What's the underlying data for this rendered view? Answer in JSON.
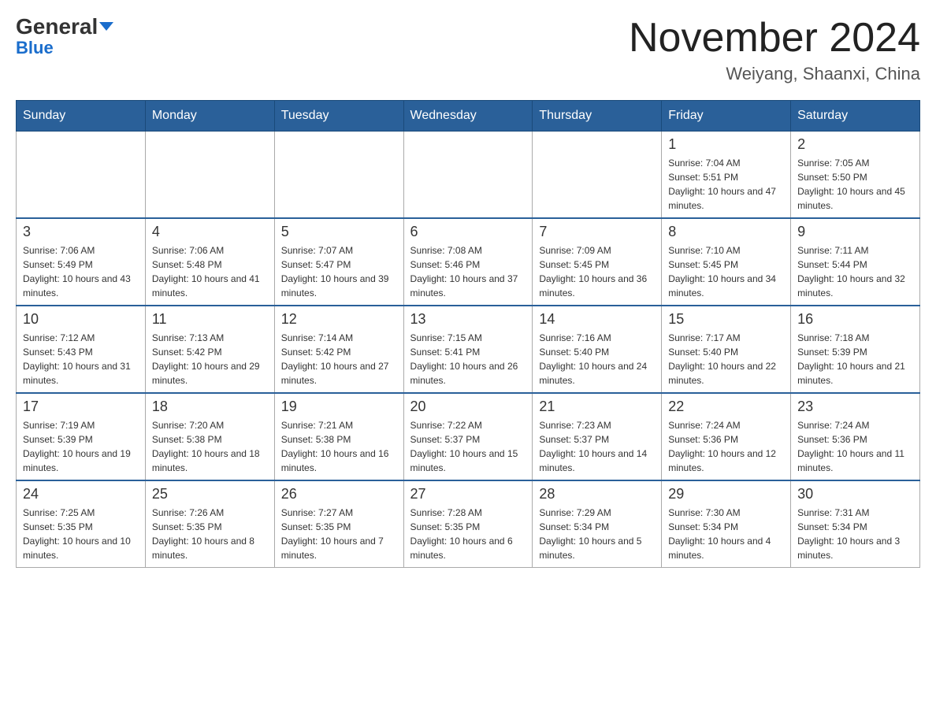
{
  "header": {
    "logo_main": "General",
    "logo_sub": "Blue",
    "month_title": "November 2024",
    "location": "Weiyang, Shaanxi, China"
  },
  "weekdays": [
    "Sunday",
    "Monday",
    "Tuesday",
    "Wednesday",
    "Thursday",
    "Friday",
    "Saturday"
  ],
  "weeks": [
    [
      {
        "day": "",
        "info": ""
      },
      {
        "day": "",
        "info": ""
      },
      {
        "day": "",
        "info": ""
      },
      {
        "day": "",
        "info": ""
      },
      {
        "day": "",
        "info": ""
      },
      {
        "day": "1",
        "info": "Sunrise: 7:04 AM\nSunset: 5:51 PM\nDaylight: 10 hours and 47 minutes."
      },
      {
        "day": "2",
        "info": "Sunrise: 7:05 AM\nSunset: 5:50 PM\nDaylight: 10 hours and 45 minutes."
      }
    ],
    [
      {
        "day": "3",
        "info": "Sunrise: 7:06 AM\nSunset: 5:49 PM\nDaylight: 10 hours and 43 minutes."
      },
      {
        "day": "4",
        "info": "Sunrise: 7:06 AM\nSunset: 5:48 PM\nDaylight: 10 hours and 41 minutes."
      },
      {
        "day": "5",
        "info": "Sunrise: 7:07 AM\nSunset: 5:47 PM\nDaylight: 10 hours and 39 minutes."
      },
      {
        "day": "6",
        "info": "Sunrise: 7:08 AM\nSunset: 5:46 PM\nDaylight: 10 hours and 37 minutes."
      },
      {
        "day": "7",
        "info": "Sunrise: 7:09 AM\nSunset: 5:45 PM\nDaylight: 10 hours and 36 minutes."
      },
      {
        "day": "8",
        "info": "Sunrise: 7:10 AM\nSunset: 5:45 PM\nDaylight: 10 hours and 34 minutes."
      },
      {
        "day": "9",
        "info": "Sunrise: 7:11 AM\nSunset: 5:44 PM\nDaylight: 10 hours and 32 minutes."
      }
    ],
    [
      {
        "day": "10",
        "info": "Sunrise: 7:12 AM\nSunset: 5:43 PM\nDaylight: 10 hours and 31 minutes."
      },
      {
        "day": "11",
        "info": "Sunrise: 7:13 AM\nSunset: 5:42 PM\nDaylight: 10 hours and 29 minutes."
      },
      {
        "day": "12",
        "info": "Sunrise: 7:14 AM\nSunset: 5:42 PM\nDaylight: 10 hours and 27 minutes."
      },
      {
        "day": "13",
        "info": "Sunrise: 7:15 AM\nSunset: 5:41 PM\nDaylight: 10 hours and 26 minutes."
      },
      {
        "day": "14",
        "info": "Sunrise: 7:16 AM\nSunset: 5:40 PM\nDaylight: 10 hours and 24 minutes."
      },
      {
        "day": "15",
        "info": "Sunrise: 7:17 AM\nSunset: 5:40 PM\nDaylight: 10 hours and 22 minutes."
      },
      {
        "day": "16",
        "info": "Sunrise: 7:18 AM\nSunset: 5:39 PM\nDaylight: 10 hours and 21 minutes."
      }
    ],
    [
      {
        "day": "17",
        "info": "Sunrise: 7:19 AM\nSunset: 5:39 PM\nDaylight: 10 hours and 19 minutes."
      },
      {
        "day": "18",
        "info": "Sunrise: 7:20 AM\nSunset: 5:38 PM\nDaylight: 10 hours and 18 minutes."
      },
      {
        "day": "19",
        "info": "Sunrise: 7:21 AM\nSunset: 5:38 PM\nDaylight: 10 hours and 16 minutes."
      },
      {
        "day": "20",
        "info": "Sunrise: 7:22 AM\nSunset: 5:37 PM\nDaylight: 10 hours and 15 minutes."
      },
      {
        "day": "21",
        "info": "Sunrise: 7:23 AM\nSunset: 5:37 PM\nDaylight: 10 hours and 14 minutes."
      },
      {
        "day": "22",
        "info": "Sunrise: 7:24 AM\nSunset: 5:36 PM\nDaylight: 10 hours and 12 minutes."
      },
      {
        "day": "23",
        "info": "Sunrise: 7:24 AM\nSunset: 5:36 PM\nDaylight: 10 hours and 11 minutes."
      }
    ],
    [
      {
        "day": "24",
        "info": "Sunrise: 7:25 AM\nSunset: 5:35 PM\nDaylight: 10 hours and 10 minutes."
      },
      {
        "day": "25",
        "info": "Sunrise: 7:26 AM\nSunset: 5:35 PM\nDaylight: 10 hours and 8 minutes."
      },
      {
        "day": "26",
        "info": "Sunrise: 7:27 AM\nSunset: 5:35 PM\nDaylight: 10 hours and 7 minutes."
      },
      {
        "day": "27",
        "info": "Sunrise: 7:28 AM\nSunset: 5:35 PM\nDaylight: 10 hours and 6 minutes."
      },
      {
        "day": "28",
        "info": "Sunrise: 7:29 AM\nSunset: 5:34 PM\nDaylight: 10 hours and 5 minutes."
      },
      {
        "day": "29",
        "info": "Sunrise: 7:30 AM\nSunset: 5:34 PM\nDaylight: 10 hours and 4 minutes."
      },
      {
        "day": "30",
        "info": "Sunrise: 7:31 AM\nSunset: 5:34 PM\nDaylight: 10 hours and 3 minutes."
      }
    ]
  ]
}
